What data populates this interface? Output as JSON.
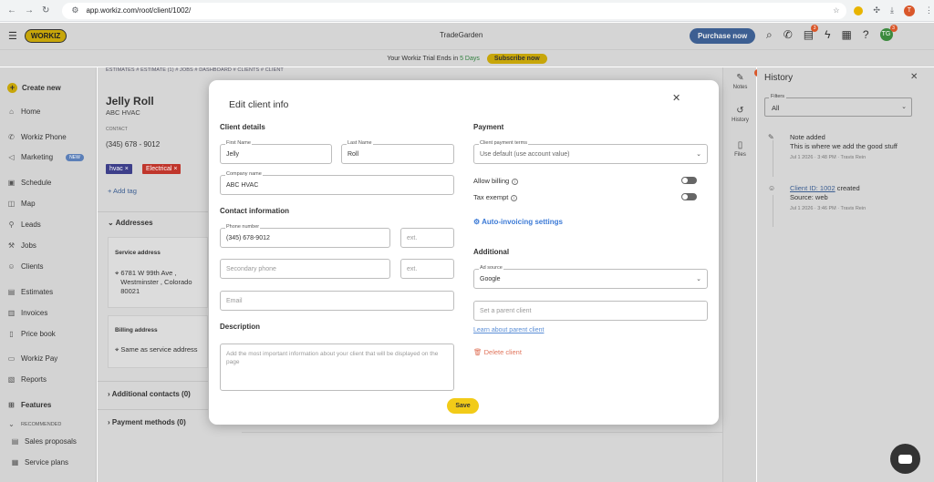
{
  "browser": {
    "url": "app.workiz.com/root/client/1002/",
    "profile_initial": "T"
  },
  "header": {
    "logo": "WORKIZ",
    "company": "TradeGarden",
    "purchase_label": "Purchase now",
    "messages_badge": "3",
    "avatar_initials": "TG",
    "avatar_badge": "3"
  },
  "trial": {
    "text_before": "Your Workiz Trial Ends in",
    "days": "5 Days",
    "subscribe_label": "Subscribe now"
  },
  "sidebar": {
    "create_label": "Create new",
    "items": [
      {
        "label": "Home",
        "icon": "home-icon"
      },
      {
        "label": "Workiz Phone",
        "icon": "phone-icon"
      },
      {
        "label": "Marketing",
        "icon": "megaphone-icon",
        "badge": "NEW"
      },
      {
        "label": "Schedule",
        "icon": "calendar-icon"
      },
      {
        "label": "Map",
        "icon": "map-icon"
      },
      {
        "label": "Leads",
        "icon": "leads-icon"
      },
      {
        "label": "Jobs",
        "icon": "wrench-icon"
      },
      {
        "label": "Clients",
        "icon": "users-icon"
      },
      {
        "label": "Estimates",
        "icon": "estimate-icon"
      },
      {
        "label": "Invoices",
        "icon": "invoice-icon"
      },
      {
        "label": "Price book",
        "icon": "book-icon"
      },
      {
        "label": "Workiz Pay",
        "icon": "card-icon"
      },
      {
        "label": "Reports",
        "icon": "report-icon"
      },
      {
        "label": "Features",
        "icon": "features-icon"
      },
      {
        "label": "RECOMMENDED",
        "icon": "chevron-down-icon"
      },
      {
        "label": "Sales proposals",
        "icon": "proposal-icon"
      },
      {
        "label": "Service plans",
        "icon": "plan-icon"
      }
    ]
  },
  "page": {
    "breadcrumb": "ESTIMATES # ESTIMATE (1) # JOBS # DASHBOARD # CLIENTS # CLIENT",
    "client_name": "Jelly Roll",
    "company": "ABC HVAC",
    "contact_label": "CONTACT",
    "phone": "(345) 678 - 9012",
    "tags": [
      {
        "label": "hvac ×",
        "color": "#3d3f8a"
      },
      {
        "label": "Electrical ×",
        "color": "#c0362c"
      }
    ],
    "add_tag": "+ Add tag",
    "addresses_title": "Addresses",
    "service_address_title": "Service address",
    "service_address_lines": [
      "6781 W 99th Ave ,",
      "Westminster , Colorado",
      "80021"
    ],
    "billing_address_title": "Billing address",
    "billing_address": "Same as service address",
    "additional_contacts": "Additional contacts (0)",
    "payment_methods": "Payment methods (0)"
  },
  "right_strip": {
    "notes_label": "Notes",
    "notes_badge": "1",
    "history_label": "History",
    "files_label": "Files"
  },
  "history": {
    "title": "History",
    "filters_label": "Filters",
    "filters_value": "All",
    "events": [
      {
        "title": "Note added",
        "body": "This is where we add the good stuff",
        "meta": "Jul 1 2026  ·  3:48 PM  ·  Travis Rein"
      },
      {
        "link": "Client ID: 1002",
        "after": " created",
        "body": "Source: web",
        "meta": "Jul 1 2026  ·  3:46 PM  ·  Travis Rein"
      }
    ]
  },
  "modal": {
    "title": "Edit client info",
    "client_details": "Client details",
    "first_name_label": "First Name",
    "first_name": "Jelly",
    "last_name_label": "Last Name",
    "last_name": "Roll",
    "company_label": "Company name",
    "company": "ABC HVAC",
    "contact_info": "Contact information",
    "phone_label": "Phone number",
    "phone": "(345) 678-9012",
    "ext_placeholder": "ext.",
    "secondary_phone_placeholder": "Secondary phone",
    "email_placeholder": "Email",
    "description_title": "Description",
    "description_placeholder": "Add the most important information about your client that will be displayed on the page",
    "payment": "Payment",
    "payment_terms_label": "Client payment terms",
    "payment_terms_value": "Use default (use account value)",
    "allow_billing": "Allow billing",
    "tax_exempt": "Tax exempt",
    "auto_invoicing": "Auto-invoicing settings",
    "additional": "Additional",
    "ad_source_label": "Ad source",
    "ad_source_value": "Google",
    "parent_client_placeholder": "Set a parent client",
    "learn_parent": "Learn about parent client",
    "delete_client": "Delete client",
    "save_label": "Save"
  }
}
